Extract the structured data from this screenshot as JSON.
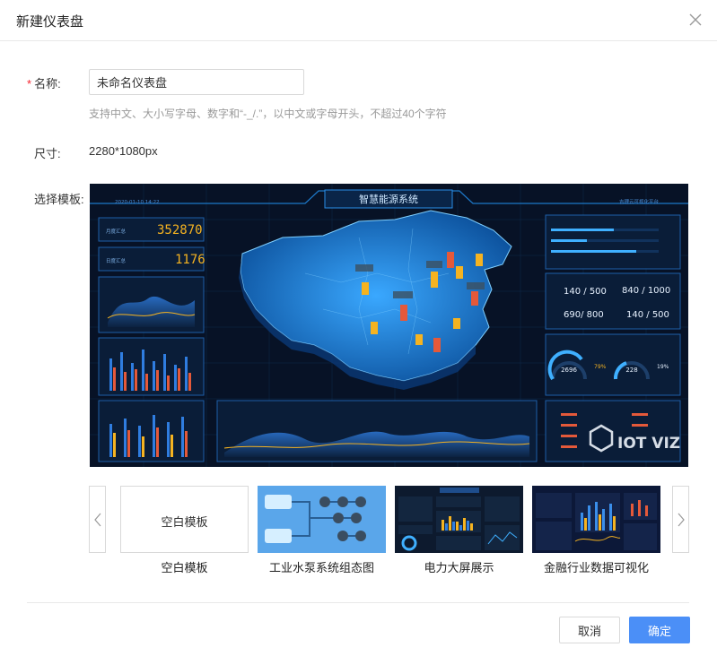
{
  "dialog": {
    "title": "新建仪表盘",
    "close_icon": "close-icon"
  },
  "form": {
    "name_label": "名称:",
    "name_required_mark": "*",
    "name_value": "未命名仪表盘",
    "name_hint": "支持中文、大小写字母、数字和“-_/.”，以中文或字母开头，不超过40个字符",
    "size_label": "尺寸:",
    "size_value": "2280*1080px",
    "template_label": "选择模板:"
  },
  "preview": {
    "title": "智慧能源系统",
    "date": "2020-01-10 14:22",
    "platform": "吉理云可视化平台",
    "counter1_label": "月度汇总",
    "counter1_value": "352870",
    "counter2_label": "日度汇总",
    "counter2_value": "1176",
    "stat_values": [
      "140 / 500",
      "840 / 1000",
      "690/ 800",
      "140 / 500"
    ],
    "gauge1": "2696",
    "gauge1_pct": "79%",
    "gauge2": "228",
    "gauge2_pct": "19%",
    "watermark": "IOT VIZ"
  },
  "templates": [
    {
      "label": "空白模板",
      "thumb_text": "空白模板"
    },
    {
      "label": "工业水泵系统组态图"
    },
    {
      "label": "电力大屏展示"
    },
    {
      "label": "金融行业数据可视化"
    }
  ],
  "footer": {
    "cancel": "取消",
    "confirm": "确定"
  },
  "colors": {
    "primary": "#4b8ff7",
    "required": "#f5222d",
    "preview_bg": "#071226"
  }
}
